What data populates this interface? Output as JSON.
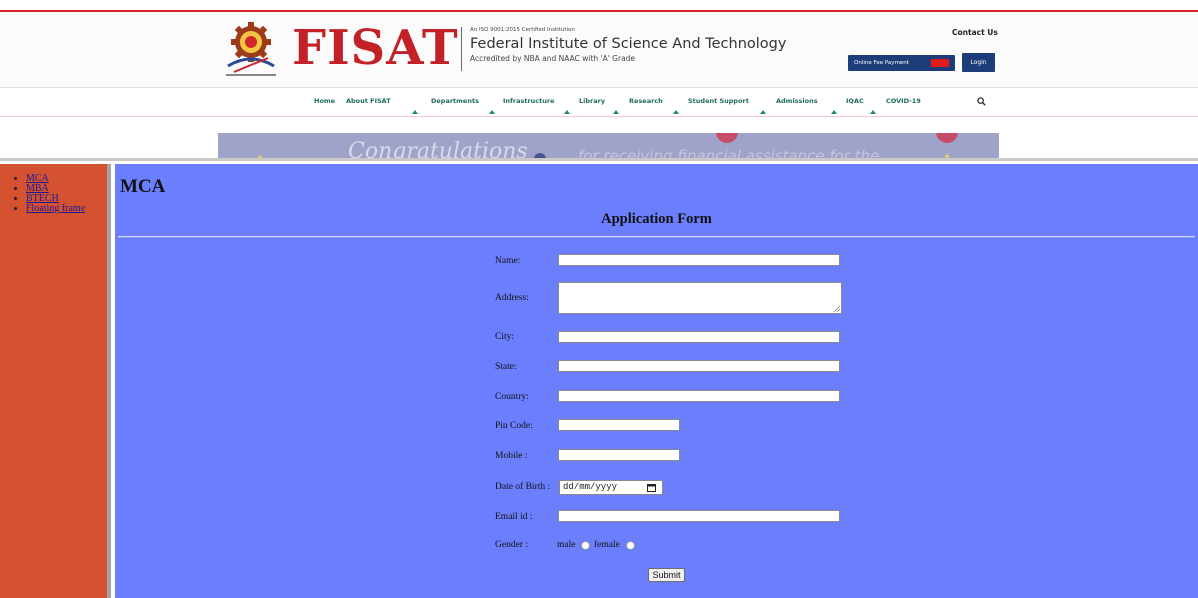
{
  "header": {
    "logo_text": "FISAT",
    "iso_text": "An ISO 9001:2015 Certified Institution",
    "institute_name": "Federal Institute of Science And Technology",
    "accreditation": "Accredited by NBA and NAAC with 'A' Grade",
    "contact_label": "Contact Us",
    "fee_payment_label": "Online Fee Payment",
    "login_label": "Login",
    "brand_color": "#c32128",
    "button_color": "#1d3d7a"
  },
  "nav": {
    "items": [
      {
        "label": "Home"
      },
      {
        "label": "About FISAT"
      },
      {
        "label": "Departments"
      },
      {
        "label": "Infrastructure"
      },
      {
        "label": "Library"
      },
      {
        "label": "Research"
      },
      {
        "label": "Student Support"
      },
      {
        "label": "Admissions"
      },
      {
        "label": "IQAC"
      },
      {
        "label": "COVID-19"
      }
    ],
    "search_icon": "search-icon"
  },
  "banner": {
    "text": "for receiving financial assistance for the",
    "script_text": "Congratulations"
  },
  "sidebar": {
    "items": [
      {
        "label": "MCA"
      },
      {
        "label": "MBA"
      },
      {
        "label": "BTECH"
      },
      {
        "label": "Floating frame"
      }
    ],
    "background": "#d45230"
  },
  "main": {
    "heading": "MCA",
    "form_title": "Application Form",
    "background": "#6b7efc",
    "fields": {
      "name": {
        "label": "Name:",
        "value": ""
      },
      "address": {
        "label": "Address:",
        "value": ""
      },
      "city": {
        "label": "City:",
        "value": ""
      },
      "state": {
        "label": "State:",
        "value": ""
      },
      "country": {
        "label": "Country:",
        "value": ""
      },
      "pin": {
        "label": "Pin Code:",
        "value": ""
      },
      "mobile": {
        "label": "Mobile :",
        "value": ""
      },
      "dob": {
        "label": "Date of Birth :",
        "value": "dd/mm/yyyy"
      },
      "email": {
        "label": "Email id :",
        "value": ""
      },
      "gender": {
        "label": "Gender :",
        "options": [
          "male",
          "female"
        ]
      }
    },
    "submit_label": "Submit"
  }
}
